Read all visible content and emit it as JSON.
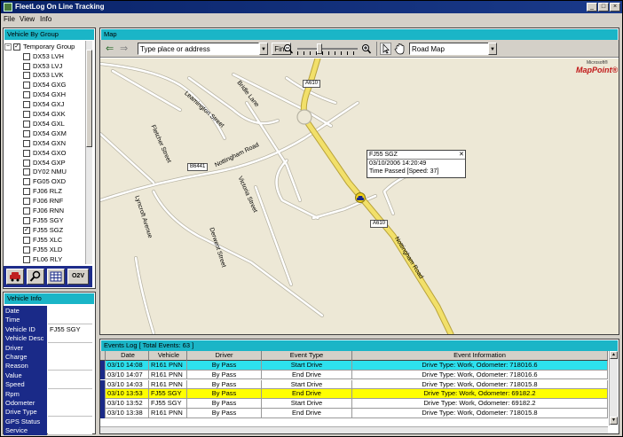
{
  "window": {
    "title": "FleetLog On Line Tracking",
    "buttons": [
      "_",
      "□",
      "×"
    ]
  },
  "menu": [
    "File",
    "View",
    "Info"
  ],
  "vehicle_group": {
    "title": "Vehicle By Group",
    "group_label": "Temporary Group",
    "vehicles": [
      {
        "reg": "DX53 LVH",
        "checked": false
      },
      {
        "reg": "DX53 LVJ",
        "checked": false
      },
      {
        "reg": "DX53 LVK",
        "checked": false
      },
      {
        "reg": "DX54 GXG",
        "checked": false
      },
      {
        "reg": "DX54 GXH",
        "checked": false
      },
      {
        "reg": "DX54 GXJ",
        "checked": false
      },
      {
        "reg": "DX54 GXK",
        "checked": false
      },
      {
        "reg": "DX54 GXL",
        "checked": false
      },
      {
        "reg": "DX54 GXM",
        "checked": false
      },
      {
        "reg": "DX54 GXN",
        "checked": false
      },
      {
        "reg": "DX54 GXO",
        "checked": false
      },
      {
        "reg": "DX54 GXP",
        "checked": false
      },
      {
        "reg": "DY02 NMU",
        "checked": false
      },
      {
        "reg": "FG05 OXD",
        "checked": false
      },
      {
        "reg": "FJ06 RLZ",
        "checked": false
      },
      {
        "reg": "FJ06 RNF",
        "checked": false
      },
      {
        "reg": "FJ06 RNN",
        "checked": false
      },
      {
        "reg": "FJ55 SGY",
        "checked": false
      },
      {
        "reg": "FJ55 SGZ",
        "checked": true
      },
      {
        "reg": "FJ55 XLC",
        "checked": false
      },
      {
        "reg": "FJ55 XLD",
        "checked": false
      },
      {
        "reg": "FL06 RLY",
        "checked": false
      }
    ],
    "tool_last_label": "O2V"
  },
  "vehicle_info": {
    "title": "Vehicle Info",
    "fields": [
      {
        "label": "Date",
        "value": ""
      },
      {
        "label": "Time",
        "value": ""
      },
      {
        "label": "Vehicle ID",
        "value": "FJ55 SGY"
      },
      {
        "label": "Vehicle Desc",
        "value": ""
      },
      {
        "label": "Driver",
        "value": ""
      },
      {
        "label": "Charge",
        "value": ""
      },
      {
        "label": "Reason",
        "value": ""
      },
      {
        "label": "Value",
        "value": ""
      },
      {
        "label": "Speed",
        "value": ""
      },
      {
        "label": "Rpm",
        "value": ""
      },
      {
        "label": "Odometer",
        "value": ""
      },
      {
        "label": "Drive Type",
        "value": ""
      },
      {
        "label": "GPS Status",
        "value": ""
      },
      {
        "label": "Service",
        "value": ""
      }
    ]
  },
  "map": {
    "title": "Map",
    "address_placeholder": "Type place or address",
    "find_label": "Find",
    "map_style": "Road Map",
    "brand_small": "Microsoft®",
    "brand": "MapPoint®",
    "streets": [
      "Bridle Lane",
      "Leamington Street",
      "Fletcher Street",
      "Nottingham Road",
      "Victoria Street",
      "Lyncroft Avenue",
      "Derwent Street",
      "Nottingham Road"
    ],
    "road_shields": [
      "A610",
      "B6441",
      "A610"
    ],
    "popup": {
      "vehicle": "FJ55 SGZ",
      "datetime": "03/10/2006 14:20:49",
      "detail": "Time Passed  [Speed: 37]"
    }
  },
  "events": {
    "title": "Events Log  [ Total Events: 63 ]",
    "columns": [
      "Date",
      "Vehicle",
      "Driver",
      "Event Type",
      "Event Information"
    ],
    "rows": [
      {
        "date": "03/10 14:08",
        "vehicle": "R161 PNN",
        "driver": "By Pass",
        "type": "Start Drive",
        "info": "Drive Type: Work, Odometer: 718016.6",
        "hl": "cyan"
      },
      {
        "date": "03/10 14:07",
        "vehicle": "R161 PNN",
        "driver": "By Pass",
        "type": "End Drive",
        "info": "Drive Type: Work, Odometer: 718016.6",
        "hl": ""
      },
      {
        "date": "03/10 14:03",
        "vehicle": "R161 PNN",
        "driver": "By Pass",
        "type": "Start Drive",
        "info": "Drive Type: Work, Odometer: 718015.8",
        "hl": ""
      },
      {
        "date": "03/10 13:53",
        "vehicle": "FJ55 SGY",
        "driver": "By Pass",
        "type": "End Drive",
        "info": "Drive Type: Work, Odometer: 69182.2",
        "hl": "yellow"
      },
      {
        "date": "03/10 13:52",
        "vehicle": "FJ55 SGY",
        "driver": "By Pass",
        "type": "Start Drive",
        "info": "Drive Type: Work, Odometer: 69182.2",
        "hl": ""
      },
      {
        "date": "03/10 13:38",
        "vehicle": "R161 PNN",
        "driver": "By Pass",
        "type": "End Drive",
        "info": "Drive Type: Work, Odometer: 718015.8",
        "hl": ""
      }
    ]
  },
  "colors": {
    "panel_title": "#1ab5c7",
    "navy": "#1a2a88",
    "highlight_cyan": "#2de1ee",
    "highlight_yellow": "#ffff00",
    "major_road": "#f2e06a"
  }
}
